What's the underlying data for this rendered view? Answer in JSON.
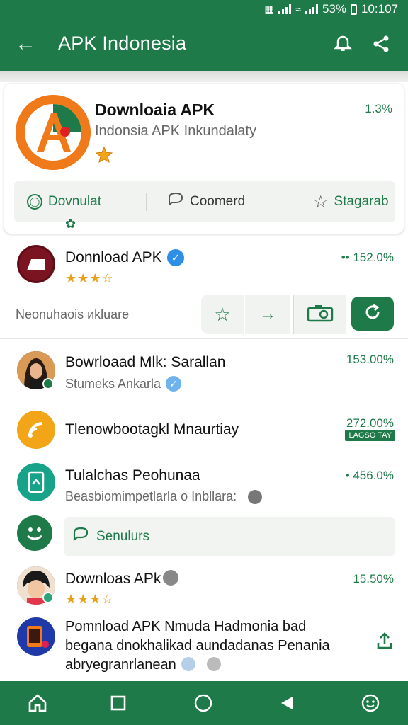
{
  "status": {
    "battery": "53%",
    "time": "10:107"
  },
  "appbar": {
    "title": "APK Indonesia"
  },
  "featured": {
    "title": "Downloaia APK",
    "subtitle": "Indonsia APK Inkundalaty",
    "percent": "1.3%",
    "actions": {
      "download": "Dovnulat",
      "comment": "Coomerd",
      "star": "Stagarab"
    }
  },
  "items": [
    {
      "title": "Donnload APK",
      "percent": "•• 152.0%",
      "rating": "★★★☆",
      "note": "Neonuhaois иkluare"
    },
    {
      "title": "Bowrloaad Mlk: Sarallan",
      "subtitle": "Stumeks Ankarla",
      "percent": "153.00%"
    },
    {
      "title": "Tlenowbootagkl Mnaurtiay",
      "percent": "272.00%",
      "tag": "LAGSO TAY"
    },
    {
      "title": "Tulalchas Peohunaa",
      "subtitle": "Beasbiomimpetlarlа o Inbllara:",
      "percent": "• 456.0%"
    },
    {
      "chip": "Senulurs"
    },
    {
      "title": "Downloas APk",
      "percent": "15.50%",
      "rating": "★★★☆"
    },
    {
      "line1": "Pomnload APK Nmuda Hadmonia bad",
      "line2": "begana dnokhalikad aundadanas Penania",
      "line3": "abryegranrlanean"
    }
  ],
  "colors": {
    "brand": "#1e7a48",
    "accent": "#f07a1a",
    "star": "#e8a019",
    "verify": "#2d8fe6"
  }
}
